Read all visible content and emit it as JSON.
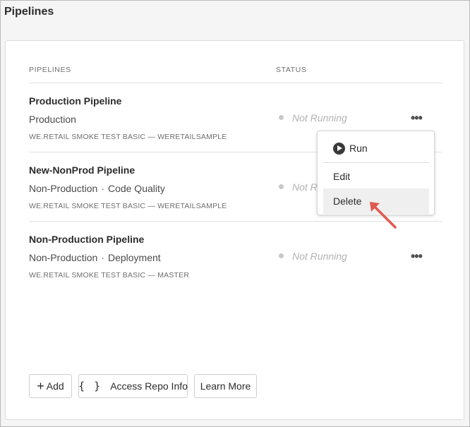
{
  "page": {
    "title": "Pipelines"
  },
  "table": {
    "headers": {
      "pipelines": "PIPELINES",
      "status": "STATUS"
    },
    "rows": [
      {
        "name": "Production Pipeline",
        "type": "Production",
        "subtype": "",
        "repo": "WE.RETAIL SMOKE TEST BASIC — WERETAILSAMPLE",
        "status": "Not Running"
      },
      {
        "name": "New-NonProd Pipeline",
        "type": "Non-Production",
        "subtype": "Code Quality",
        "repo": "WE.RETAIL SMOKE TEST BASIC — WERETAILSAMPLE",
        "status": "Not Running"
      },
      {
        "name": "Non-Production Pipeline",
        "type": "Non-Production",
        "subtype": "Deployment",
        "repo": "WE.RETAIL SMOKE TEST BASIC — MASTER",
        "status": "Not Running"
      }
    ],
    "more_label": "•••",
    "separator": "·"
  },
  "context_menu": {
    "items": [
      {
        "label": "Run",
        "icon": "play-circle-icon"
      },
      {
        "label": "Edit"
      },
      {
        "label": "Delete",
        "hovered": true
      }
    ]
  },
  "footer": {
    "add_label": "Add",
    "add_icon": "+",
    "access_repo_label": "Access Repo Info",
    "access_repo_icon": "{ }",
    "learn_more_label": "Learn More"
  },
  "colors": {
    "arrow": "#e05a4f"
  }
}
